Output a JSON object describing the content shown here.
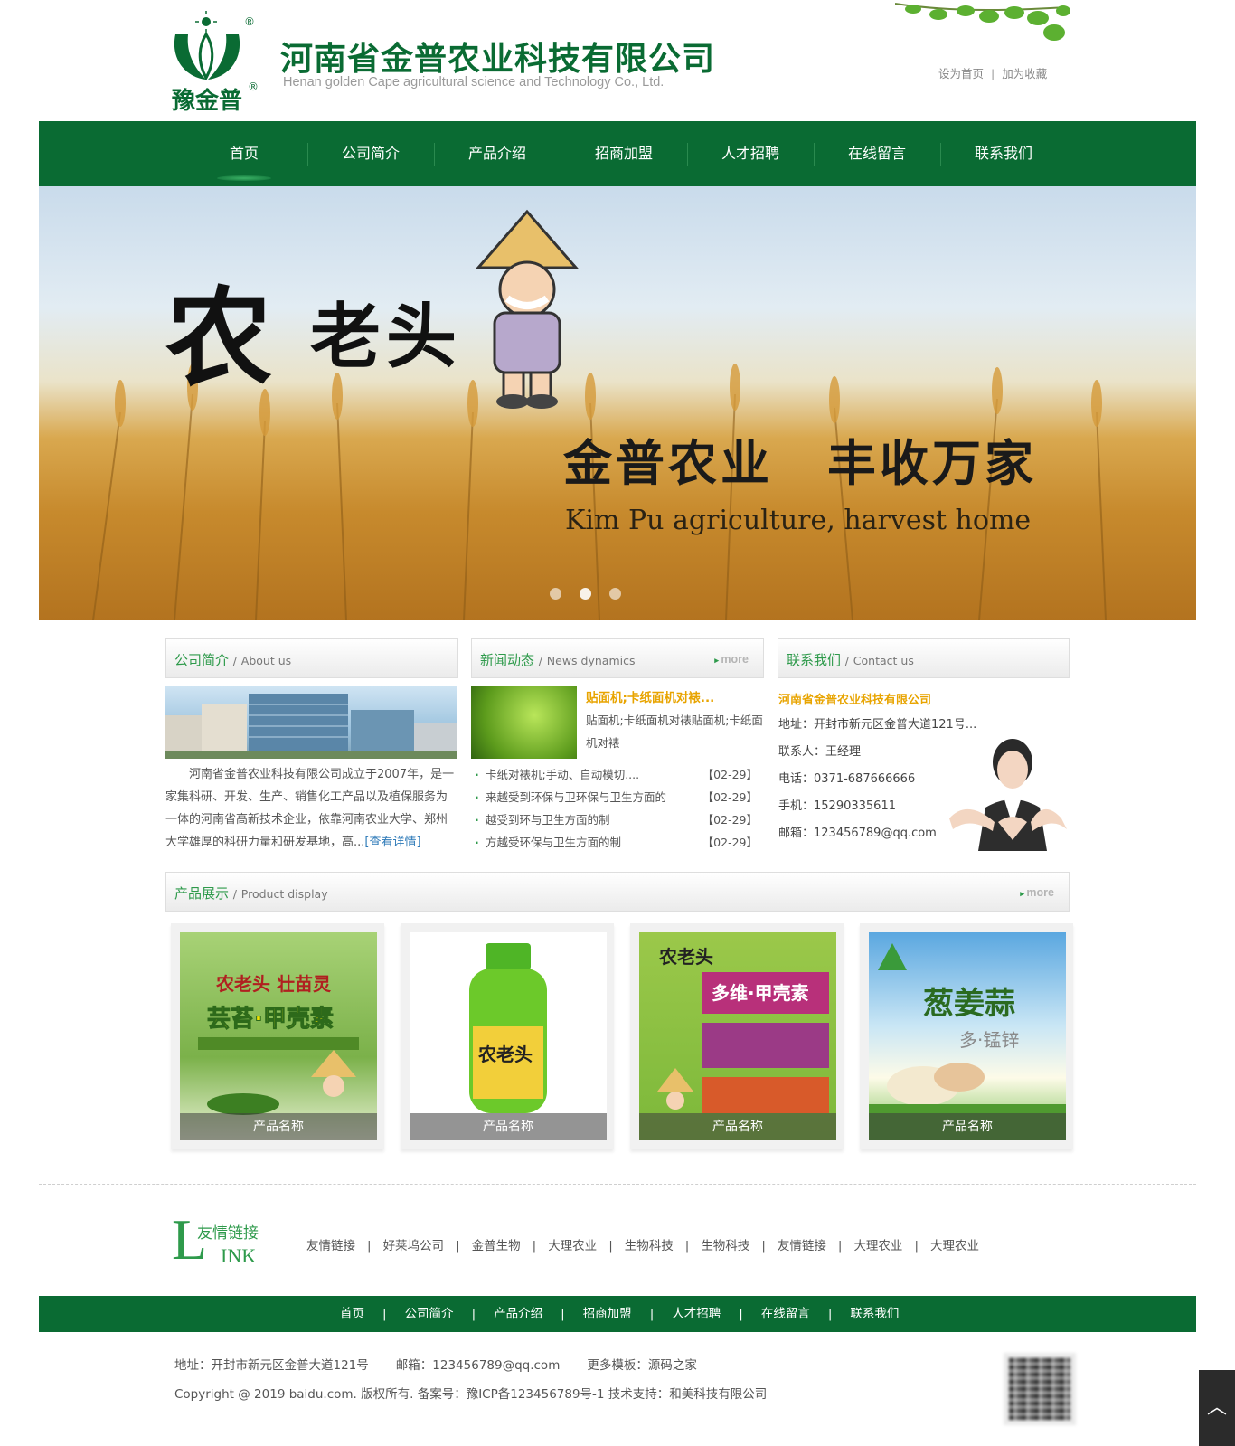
{
  "header": {
    "company_cn": "河南省金普农业科技有限公司",
    "company_en": "Henan golden Cape agricultural science and Technology Co., Ltd.",
    "logo_text": "豫金普",
    "top_links": [
      "设为首页",
      "加为收藏"
    ],
    "top_sep": "|"
  },
  "nav": {
    "items": [
      "首页",
      "公司简介",
      "产品介绍",
      "招商加盟",
      "人才招聘",
      "在线留言",
      "联系我们"
    ],
    "active_index": 0
  },
  "banner": {
    "brand_big": "农",
    "brand_rest": "老头",
    "slogan_left": "金普农业",
    "slogan_right": "丰收万家",
    "subtitle": "Kim Pu agriculture, harvest home",
    "slide_count": 3,
    "active_slide": 1
  },
  "about": {
    "title_cn": "公司简介",
    "title_sep": "/",
    "title_en": "About us",
    "text": "河南省金普农业科技有限公司成立于2007年，是一家集科研、开发、生产、销售化工产品以及植保服务为一体的河南省高新技术企业，依靠河南农业大学、郑州大学雄厚的科研力量和研发基地，高...",
    "detail_link": "[查看详情]"
  },
  "news": {
    "title_cn": "新闻动态",
    "title_sep": "/",
    "title_en": "News dynamics",
    "more": "more",
    "top_title": "贴面机;卡纸面机对裱...",
    "top_desc": "贴面机;卡纸面机对裱贴面机;卡纸面机对裱",
    "items": [
      {
        "title": "卡纸对裱机;手动、自动模切....",
        "date": "【02-29】"
      },
      {
        "title": "来越受到环保与卫环保与卫生方面的",
        "date": "【02-29】"
      },
      {
        "title": "越受到环与卫生方面的制",
        "date": "【02-29】"
      },
      {
        "title": "方越受环保与卫生方面的制",
        "date": "【02-29】"
      }
    ]
  },
  "contact": {
    "title_cn": "联系我们",
    "title_sep": "/",
    "title_en": "Contact us",
    "company": "河南省金普农业科技有限公司",
    "lines": [
      "地址：开封市新元区金普大道121号...",
      "联系人：王经理",
      "电话：0371-687666666",
      "手机：15290335611",
      "邮箱：123456789@qq.com"
    ]
  },
  "products": {
    "title_cn": "产品展示",
    "title_sep": "/",
    "title_en": "Product display",
    "more": "more",
    "items": [
      {
        "caption": "产品名称",
        "label_top": "农老头 壮苗灵",
        "label_main": "芸苔·甲壳素"
      },
      {
        "caption": "产品名称",
        "label_main": "农老头"
      },
      {
        "caption": "产品名称",
        "label_top": "农老头",
        "label_main": "多维·甲壳素"
      },
      {
        "caption": "产品名称",
        "label_main": "葱姜蒜",
        "label_sub": "多·锰锌"
      }
    ]
  },
  "links": {
    "big_letter": "L",
    "title_cn": "友情链接",
    "title_en": "INK",
    "items": [
      "友情链接",
      "好莱坞公司",
      "金普生物",
      "大理农业",
      "生物科技",
      "生物科技",
      "友情链接",
      "大理农业",
      "大理农业"
    ],
    "sep": "|"
  },
  "footer": {
    "nav": [
      "首页",
      "公司简介",
      "产品介绍",
      "招商加盟",
      "人才招聘",
      "在线留言",
      "联系我们"
    ],
    "sep": "|",
    "address": "地址：开封市新元区金普大道121号",
    "email": "邮箱：123456789@qq.com",
    "templates": "更多模板：源码之家",
    "copyright": "Copyright @ 2019 baidu.com. 版权所有. 备案号：豫ICP备123456789号-1   技术支持：和美科技有限公司"
  },
  "colors": {
    "brand_green": "#0a6b33",
    "accent_green": "#2e9a4b",
    "highlight": "#e8a400"
  }
}
